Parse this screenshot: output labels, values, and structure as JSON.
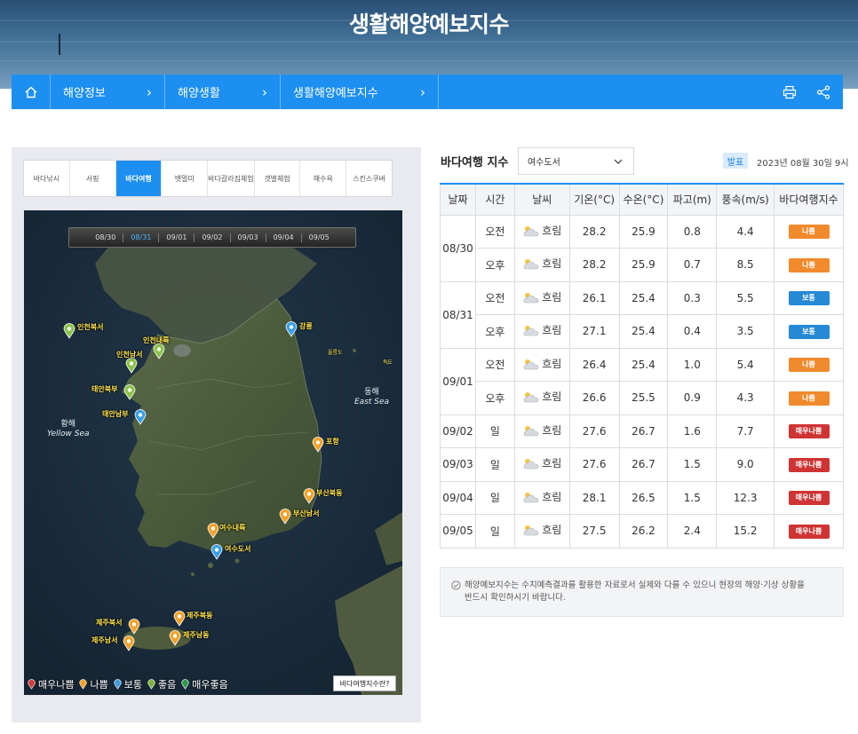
{
  "banner": {
    "title": "생활해양예보지수"
  },
  "breadcrumb": {
    "items": [
      {
        "label": "해양정보"
      },
      {
        "label": "해양생활"
      },
      {
        "label": "생활해양예보지수"
      }
    ],
    "chevron": "›"
  },
  "tabs": [
    {
      "label": "바다낚시"
    },
    {
      "label": "서핑"
    },
    {
      "label": "바다여행"
    },
    {
      "label": "뱃멀미"
    },
    {
      "label": "바다갈라짐체험"
    },
    {
      "label": "갯벌체험"
    },
    {
      "label": "해수욕"
    },
    {
      "label": "스킨스쿠버"
    }
  ],
  "map": {
    "dates": [
      "08/30",
      "08/31",
      "09/01",
      "09/02",
      "09/03",
      "09/04",
      "09/05"
    ],
    "active_date": "08/31",
    "seas": {
      "west_kr": "황해",
      "west_en": "Yellow Sea",
      "east_kr": "동해",
      "east_en": "East Sea"
    },
    "islands": {
      "ulleung": "울릉도",
      "dokdo": "독도"
    },
    "stations": [
      {
        "label": "인천북서",
        "status": "good"
      },
      {
        "label": "인천내륙",
        "status": "good"
      },
      {
        "label": "인천남서",
        "status": "good"
      },
      {
        "label": "태안북부",
        "status": "good"
      },
      {
        "label": "태안남부",
        "status": "normal"
      },
      {
        "label": "강릉",
        "status": "normal"
      },
      {
        "label": "포항",
        "status": "bad"
      },
      {
        "label": "부산북동",
        "status": "bad"
      },
      {
        "label": "부산남서",
        "status": "bad"
      },
      {
        "label": "여수내륙",
        "status": "bad"
      },
      {
        "label": "여수도서",
        "status": "normal"
      },
      {
        "label": "제주북서",
        "status": "bad"
      },
      {
        "label": "제주북동",
        "status": "bad"
      },
      {
        "label": "제주남서",
        "status": "bad"
      },
      {
        "label": "제주남동",
        "status": "bad"
      }
    ],
    "legend": [
      {
        "label": "매우나쁨",
        "color": "#d53a3a"
      },
      {
        "label": "나쁨",
        "color": "#f2a22a"
      },
      {
        "label": "보통",
        "color": "#3a9de0"
      },
      {
        "label": "좋음",
        "color": "#7fb23a"
      },
      {
        "label": "매우좋음",
        "color": "#2e9b4e"
      }
    ],
    "legend_button": "바다여행지수란?"
  },
  "right": {
    "title": "바다여행 지수",
    "select_value": "여수도서",
    "announce_label": "발표",
    "announce_date": "2023년 08월 30일 9시",
    "table_headers": [
      "날짜",
      "시간",
      "날씨",
      "기온(°C)",
      "수온(°C)",
      "파고(m)",
      "풍속(m/s)",
      "바다여행지수"
    ],
    "rows": [
      {
        "date": "08/30",
        "time": "오전",
        "weather": "흐림",
        "temp": "28.2",
        "water": "25.9",
        "wave": "0.8",
        "wind": "4.4",
        "index": "나쁨",
        "level": "bad"
      },
      {
        "date": "",
        "time": "오후",
        "weather": "흐림",
        "temp": "28.2",
        "water": "25.9",
        "wave": "0.7",
        "wind": "8.5",
        "index": "나쁨",
        "level": "bad"
      },
      {
        "date": "08/31",
        "time": "오전",
        "weather": "흐림",
        "temp": "26.1",
        "water": "25.4",
        "wave": "0.3",
        "wind": "5.5",
        "index": "보통",
        "level": "normal"
      },
      {
        "date": "",
        "time": "오후",
        "weather": "흐림",
        "temp": "27.1",
        "water": "25.4",
        "wave": "0.4",
        "wind": "3.5",
        "index": "보통",
        "level": "normal"
      },
      {
        "date": "09/01",
        "time": "오전",
        "weather": "흐림",
        "temp": "26.4",
        "water": "25.4",
        "wave": "1.0",
        "wind": "5.4",
        "index": "나쁨",
        "level": "bad"
      },
      {
        "date": "",
        "time": "오후",
        "weather": "흐림",
        "temp": "26.6",
        "water": "25.5",
        "wave": "0.9",
        "wind": "4.3",
        "index": "나쁨",
        "level": "bad"
      },
      {
        "date": "09/02",
        "time": "일",
        "weather": "흐림",
        "temp": "27.6",
        "water": "26.7",
        "wave": "1.6",
        "wind": "7.7",
        "index": "매우나쁨",
        "level": "very-bad"
      },
      {
        "date": "09/03",
        "time": "일",
        "weather": "흐림",
        "temp": "27.6",
        "water": "26.7",
        "wave": "1.5",
        "wind": "9.0",
        "index": "매우나쁨",
        "level": "very-bad"
      },
      {
        "date": "09/04",
        "time": "일",
        "weather": "흐림",
        "temp": "28.1",
        "water": "26.5",
        "wave": "1.5",
        "wind": "12.3",
        "index": "매우나쁨",
        "level": "very-bad"
      },
      {
        "date": "09/05",
        "time": "일",
        "weather": "흐림",
        "temp": "27.5",
        "water": "26.2",
        "wave": "2.4",
        "wind": "15.2",
        "index": "매우나쁨",
        "level": "very-bad"
      }
    ],
    "level_colors": {
      "bad": "#f08a2c",
      "normal": "#2589d6",
      "very-bad": "#cf3434"
    },
    "note_line1": "해양예보지수는 수치예측결과를 활용한 자료로서 실제와 다를 수 있으니 현장의 해양·기상 상황을",
    "note_line2": "반드시 확인하시기 바랍니다."
  }
}
